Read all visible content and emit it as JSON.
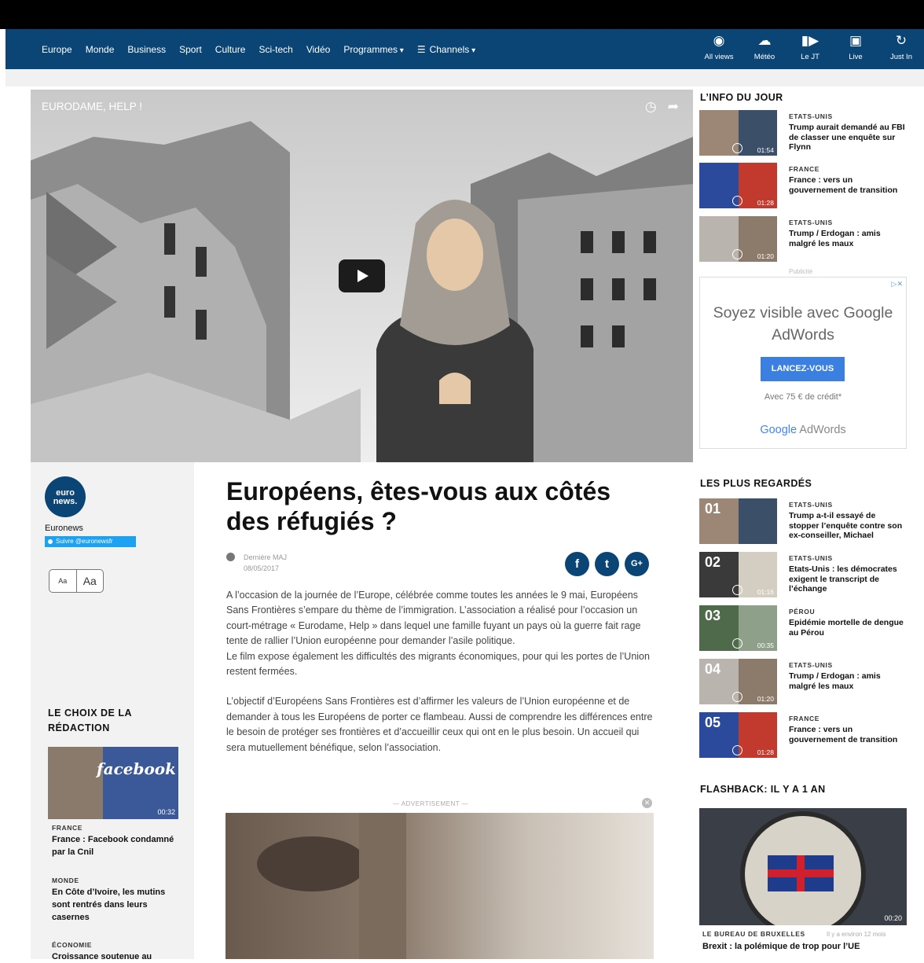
{
  "nav": {
    "links": [
      "Europe",
      "Monde",
      "Business",
      "Sport",
      "Culture",
      "Sci-tech",
      "Vidéo",
      "Programmes",
      "Channels"
    ],
    "icons": [
      {
        "label": "All views",
        "icon": "eye-icon",
        "glyph": "◉"
      },
      {
        "label": "Météo",
        "icon": "weather-icon",
        "glyph": "☁"
      },
      {
        "label": "Le JT",
        "icon": "jt-icon",
        "glyph": "▮▶"
      },
      {
        "label": "Live",
        "icon": "live-icon",
        "glyph": "▣"
      },
      {
        "label": "Just In",
        "icon": "refresh-icon",
        "glyph": "↻"
      }
    ]
  },
  "video": {
    "title": "EURODAME, HELP !"
  },
  "brand": {
    "logo_text": "euro news.",
    "name": "Euronews",
    "follow": "Suivre @euronewsfr",
    "font_small": "Aa",
    "font_large": "Aa"
  },
  "article": {
    "title": "Européens, êtes-vous aux côtés des réfugiés ?",
    "meta_label": "Dernière MAJ",
    "meta_date": "08/05/2017",
    "shares": [
      "f",
      "t",
      "G+"
    ],
    "p1": "A l’occasion de la journée de l’Europe, célébrée comme toutes les années le 9 mai, Européens Sans Frontières s’empare du thème de l’immigration. L’association a réalisé pour l’occasion un court-métrage « Eurodame, Help » dans lequel une famille fuyant un pays où la guerre fait rage tente de rallier l’Union européenne pour demander l’asile politique.",
    "p1b": "Le film expose également les difficultés des migrants économiques, pour qui les portes de l’Union restent fermées.",
    "p2": "L’objectif d’Européens Sans Frontières est d’affirmer les valeurs de l’Union européenne et de demander à tous les Européens de porter ce flambeau. Aussi de comprendre les différences entre le besoin de protéger ses frontières et d’accueillir ceux qui ont en le plus besoin. Un accueil qui sera mutuellement bénéfique, selon l’association.",
    "ad_label": "— ADVERTISEMENT —"
  },
  "choix": {
    "title": "LE CHOIX DE LA RÉDACTION",
    "image_text": "facebook",
    "duration": "00:32",
    "items": [
      {
        "cat": "FRANCE",
        "title": "France : Facebook condamné par la Cnil"
      },
      {
        "cat": "MONDE",
        "title": "En Côte d’Ivoire, les mutins sont rentrés dans leurs casernes"
      },
      {
        "cat": "ÉCONOMIE",
        "title": "Croissance soutenue au"
      }
    ]
  },
  "info_du_jour": {
    "title": "L’INFO DU JOUR",
    "items": [
      {
        "cat": "ETATS-UNIS",
        "title": "Trump aurait demandé au FBI de classer une enquête sur Flynn",
        "duration": "01:54"
      },
      {
        "cat": "FRANCE",
        "title": "France : vers un gouvernement de transition",
        "duration": "01:28"
      },
      {
        "cat": "ETATS-UNIS",
        "title": "Trump / Erdogan : amis malgré les maux",
        "duration": "01:20"
      }
    ]
  },
  "ad": {
    "pub_label": "Publicité",
    "adchoice": "▷✕",
    "headline": "Soyez visible avec Google AdWords",
    "cta": "LANCEZ-VOUS",
    "credit": "Avec 75 € de crédit*",
    "logo_google": "Google",
    "logo_adwords": " AdWords"
  },
  "plus_regardes": {
    "title": "LES PLUS REGARDÉS",
    "items": [
      {
        "rank": "01",
        "cat": "ETATS-UNIS",
        "title": "Trump a-t-il essayé de stopper l’enquête contre son ex-conseiller, Michael",
        "duration": ""
      },
      {
        "rank": "02",
        "cat": "ETATS-UNIS",
        "title": "Etats-Unis : les démocrates exigent le transcript de l’échange",
        "duration": "01:16"
      },
      {
        "rank": "03",
        "cat": "PÉROU",
        "title": "Epidémie mortelle de dengue au Pérou",
        "duration": "00:35"
      },
      {
        "rank": "04",
        "cat": "ETATS-UNIS",
        "title": "Trump / Erdogan : amis malgré les maux",
        "duration": "01:20"
      },
      {
        "rank": "05",
        "cat": "FRANCE",
        "title": "France : vers un gouvernement de transition",
        "duration": "01:28"
      }
    ]
  },
  "flashback": {
    "title": "FLASHBACK: IL Y A 1 AN",
    "duration": "00:20",
    "cat": "LE BUREAU DE BRUXELLES",
    "time": "Il y a environ 12 mois",
    "item_title": "Brexit : la polémique de trop pour l’UE"
  },
  "colors": {
    "nav_bg": "#0b4576",
    "twitter": "#1da1f2",
    "cta": "#3b7fe0"
  }
}
